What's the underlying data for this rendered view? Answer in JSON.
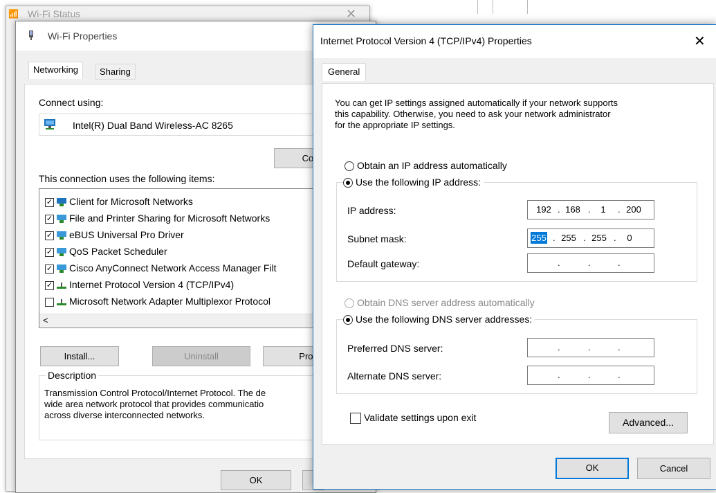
{
  "background_window": {
    "title": "Wi-Fi Status",
    "close": "✕"
  },
  "wifi_properties": {
    "title": "Wi-Fi Properties",
    "tabs": [
      {
        "label": "Networking",
        "active": true
      },
      {
        "label": "Sharing",
        "active": false
      }
    ],
    "connect_using_label": "Connect using:",
    "adapter_name": "Intel(R) Dual Band Wireless-AC 8265",
    "configure_button": "Confi",
    "items_label": "This connection uses the following items:",
    "items": [
      {
        "label": "Client for Microsoft Networks",
        "checked": true
      },
      {
        "label": "File and Printer Sharing for Microsoft Networks",
        "checked": true
      },
      {
        "label": "eBUS Universal Pro Driver",
        "checked": true
      },
      {
        "label": "QoS Packet Scheduler",
        "checked": true
      },
      {
        "label": "Cisco AnyConnect Network Access Manager Filt",
        "checked": true
      },
      {
        "label": "Internet Protocol Version 4 (TCP/IPv4)",
        "checked": true
      },
      {
        "label": "Microsoft Network Adapter Multiplexor Protocol",
        "checked": false
      }
    ],
    "scroll_left": "<",
    "install_button": "Install...",
    "uninstall_button": "Uninstall",
    "properties_button": "Prope",
    "description_label": "Description",
    "description_lines": [
      "Transmission Control Protocol/Internet Protocol. The de",
      "wide area network protocol that provides communicatio",
      "across diverse interconnected networks."
    ],
    "ok_button": "OK"
  },
  "ipv4_dialog": {
    "title": "Internet Protocol Version 4 (TCP/IPv4) Properties",
    "close": "✕",
    "tab": "General",
    "intro_lines": [
      "You can get IP settings assigned automatically if your network supports",
      "this capability. Otherwise, you need to ask your network administrator",
      "for the appropriate IP settings."
    ],
    "obtain_ip_auto": "Obtain an IP address automatically",
    "use_following_ip": "Use the following IP address:",
    "ip_address_label": "IP address:",
    "ip_address": [
      "192",
      "168",
      "1",
      "200"
    ],
    "subnet_label": "Subnet mask:",
    "subnet_mask": [
      "255",
      "255",
      "255",
      "0"
    ],
    "gateway_label": "Default gateway:",
    "gateway": [
      "",
      "",
      "",
      ""
    ],
    "obtain_dns_auto": "Obtain DNS server address automatically",
    "use_following_dns": "Use the following DNS server addresses:",
    "preferred_dns_label": "Preferred DNS server:",
    "preferred_dns": [
      "",
      "",
      "",
      ""
    ],
    "alternate_dns_label": "Alternate DNS server:",
    "alternate_dns": [
      "",
      "",
      "",
      ""
    ],
    "validate_label": "Validate settings upon exit",
    "validate_checked": false,
    "advanced_button": "Advanced...",
    "ok_button": "OK",
    "cancel_button": "Cancel",
    "ip_mode": "static",
    "dns_mode": "static"
  },
  "colors": {
    "accent": "#0078d7",
    "selection": "#0078d7",
    "dialog_bg": "#f0f0f0"
  }
}
